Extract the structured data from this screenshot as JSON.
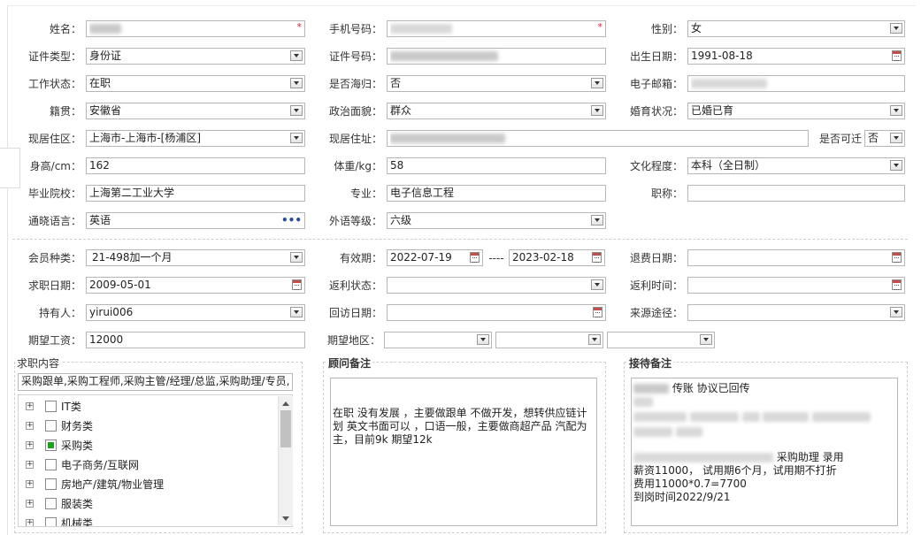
{
  "colors": {
    "required": "#dd2233",
    "checked": "#1ea11e",
    "link_dots": "#2a4a9a"
  },
  "basic": {
    "name_label": "姓名：",
    "name_value": "",
    "phone_label": "手机号码：",
    "phone_value": "",
    "gender_label": "性别：",
    "gender_value": "女",
    "id_type_label": "证件类型：",
    "id_type_value": "身份证",
    "id_no_label": "证件号码：",
    "id_no_value": "",
    "birth_label": "出生日期：",
    "birth_value": "1991-08-18",
    "work_status_label": "工作状态：",
    "work_status_value": "在职",
    "overseas_label": "是否海归：",
    "overseas_value": "否",
    "email_label": "电子邮箱：",
    "email_value": "",
    "native_label": "籍贯：",
    "native_value": "安徽省",
    "political_label": "政治面貌：",
    "political_value": "群众",
    "marital_label": "婚育状况：",
    "marital_value": "已婚已育",
    "region_label": "现居住区：",
    "region_value": "上海市-上海市-[杨浦区]",
    "address_label": "现居住址：",
    "address_value": "",
    "relocate_label": "是否可迁",
    "relocate_value": "否",
    "height_label": "身高/cm：",
    "height_value": "162",
    "weight_label": "体重/kg：",
    "weight_value": "58",
    "education_label": "文化程度：",
    "education_value": "本科（全日制）",
    "school_label": "毕业院校：",
    "school_value": "上海第二工业大学",
    "major_label": "专业：",
    "major_value": "电子信息工程",
    "title_label": "职称：",
    "title_value": "",
    "language_label": "通晓语言：",
    "language_value": "英语",
    "language_more": "•••",
    "lang_level_label": "外语等级：",
    "lang_level_value": "六级"
  },
  "membership": {
    "type_label": "会员种类：",
    "type_value": "21-498加一个月",
    "valid_label": "有效期：",
    "valid_from": "2022-07-19",
    "valid_dash": "----",
    "valid_to": "2023-02-18",
    "refund_date_label": "退费日期：",
    "refund_date_value": "",
    "apply_date_label": "求职日期：",
    "apply_date_value": "2009-05-01",
    "rebate_status_label": "返利状态：",
    "rebate_status_value": "",
    "rebate_time_label": "返利时间：",
    "rebate_time_value": "",
    "holder_label": "持有人：",
    "holder_value": "yirui006",
    "revisit_label": "回访日期：",
    "revisit_value": "",
    "source_label": "来源途径：",
    "source_value": "",
    "salary_label": "期望工资：",
    "salary_value": "12000",
    "area_label": "期望地区：",
    "area_values": [
      "",
      "",
      ""
    ]
  },
  "job_panel": {
    "title": "求职内容",
    "selected_text": "采购跟单,采购工程师,采购主管/经理/总监,采购助理/专员,仓",
    "tree": [
      {
        "label": "IT类",
        "checked": false
      },
      {
        "label": "财务类",
        "checked": false
      },
      {
        "label": "采购类",
        "checked": true
      },
      {
        "label": "电子商务/互联网",
        "checked": false
      },
      {
        "label": "房地产/建筑/物业管理",
        "checked": false
      },
      {
        "label": "服装类",
        "checked": false
      },
      {
        "label": "机械类",
        "checked": false
      }
    ]
  },
  "advisor_panel": {
    "title": "顾问备注",
    "text": "在职 没有发展 ，主要做跟单 不做开发，想转供应链计划 英文书面可以 ，口语一般，主要做商超产品 汽配为主，目前9k 期望12k"
  },
  "reception_panel": {
    "title": "接待备注",
    "line1": "传账 协议已回传",
    "line4": "采购助理   录用",
    "line5": "薪资11000， 试用期6个月，试用期不打折",
    "line6": "费用11000*0.7=7700",
    "line7": "到岗时间2022/9/21"
  }
}
